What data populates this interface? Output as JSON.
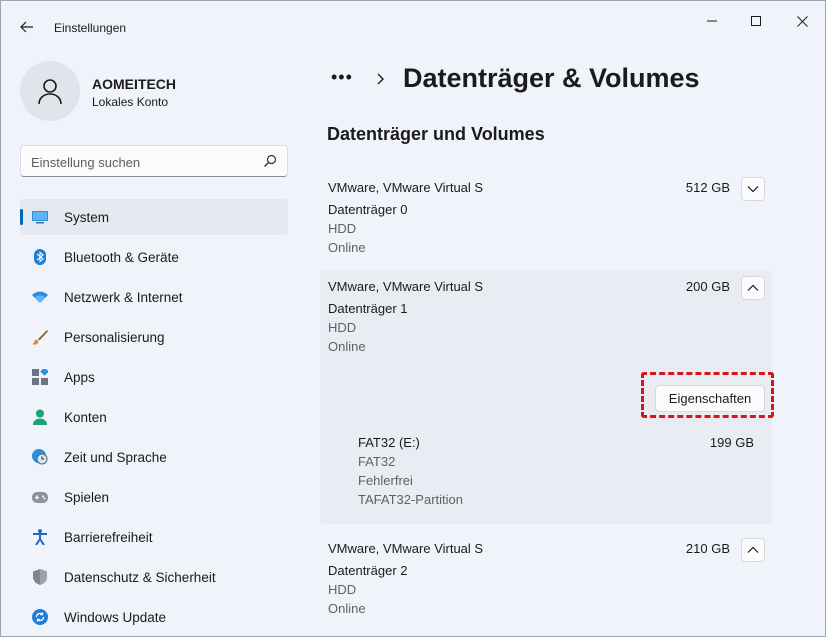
{
  "window": {
    "title": "Einstellungen"
  },
  "profile": {
    "name": "AOMEITECH",
    "account": "Lokales Konto"
  },
  "search": {
    "placeholder": "Einstellung suchen"
  },
  "nav": {
    "items": [
      {
        "label": "System",
        "icon": "monitor-icon",
        "active": true
      },
      {
        "label": "Bluetooth & Geräte",
        "icon": "bluetooth-icon"
      },
      {
        "label": "Netzwerk & Internet",
        "icon": "wifi-icon"
      },
      {
        "label": "Personalisierung",
        "icon": "brush-icon"
      },
      {
        "label": "Apps",
        "icon": "apps-icon"
      },
      {
        "label": "Konten",
        "icon": "person-icon"
      },
      {
        "label": "Zeit und Sprache",
        "icon": "clock-globe-icon"
      },
      {
        "label": "Spielen",
        "icon": "gamepad-icon"
      },
      {
        "label": "Barrierefreiheit",
        "icon": "accessibility-icon"
      },
      {
        "label": "Datenschutz & Sicherheit",
        "icon": "shield-icon"
      },
      {
        "label": "Windows Update",
        "icon": "update-icon"
      }
    ]
  },
  "breadcrumb": {
    "more": "•••",
    "title": "Datenträger & Volumes"
  },
  "section": {
    "title": "Datenträger und Volumes"
  },
  "disks": [
    {
      "model": "VMware, VMware Virtual S",
      "size": "512 GB",
      "name": "Datenträger 0",
      "type": "HDD",
      "status": "Online",
      "expanded": false
    },
    {
      "model": "VMware, VMware Virtual S",
      "size": "200 GB",
      "name": "Datenträger 1",
      "type": "HDD",
      "status": "Online",
      "expanded": true,
      "properties_label": "Eigenschaften",
      "volume": {
        "name": "FAT32 (E:)",
        "size": "199 GB",
        "fs": "FAT32",
        "health": "Fehlerfrei",
        "label": "TAFAT32-Partition"
      }
    },
    {
      "model": "VMware, VMware Virtual S",
      "size": "210 GB",
      "name": "Datenträger 2",
      "type": "HDD",
      "status": "Online",
      "expanded": false
    }
  ],
  "colors": {
    "accent": "#0067c0",
    "highlight": "#d6161b"
  }
}
